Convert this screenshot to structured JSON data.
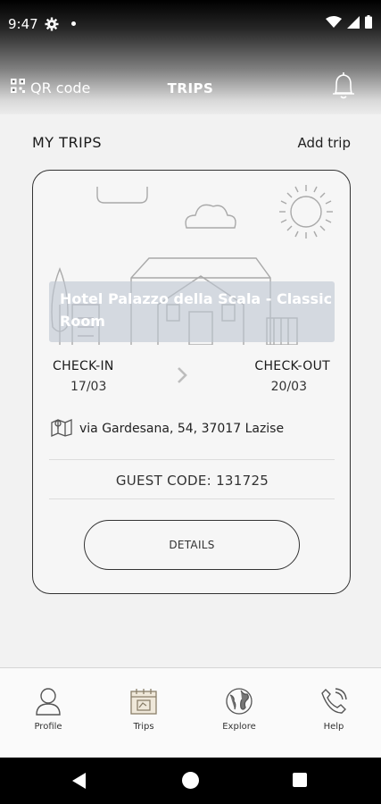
{
  "status_bar": {
    "time": "9:47",
    "icons": [
      "gear-icon",
      "notification-dot-icon",
      "wifi-icon",
      "signal-icon",
      "battery-icon"
    ]
  },
  "header": {
    "qr_label": "QR code",
    "title": "TRIPS",
    "icons": [
      "qr-icon",
      "bell-icon"
    ]
  },
  "section": {
    "title": "MY TRIPS",
    "add_label": "Add trip"
  },
  "trip": {
    "hotel_name": "Hotel Palazzo della Scala - Classic Room",
    "check_in_label": "CHECK-IN",
    "check_in_date": "17/03",
    "check_out_label": "CHECK-OUT",
    "check_out_date": "20/03",
    "address": "via Gardesana, 54, 37017 Lazise",
    "guest_code": "GUEST CODE: 131725",
    "details_label": "DETAILS"
  },
  "bottom_nav": {
    "items": [
      {
        "label": "Profile",
        "icon": "profile-icon"
      },
      {
        "label": "Trips",
        "icon": "trips-calendar-icon"
      },
      {
        "label": "Explore",
        "icon": "globe-icon"
      },
      {
        "label": "Help",
        "icon": "phone-icon"
      }
    ]
  },
  "colors": {
    "card_border": "#333333",
    "background": "#f2f2f2",
    "banner": "#bec6d2"
  }
}
